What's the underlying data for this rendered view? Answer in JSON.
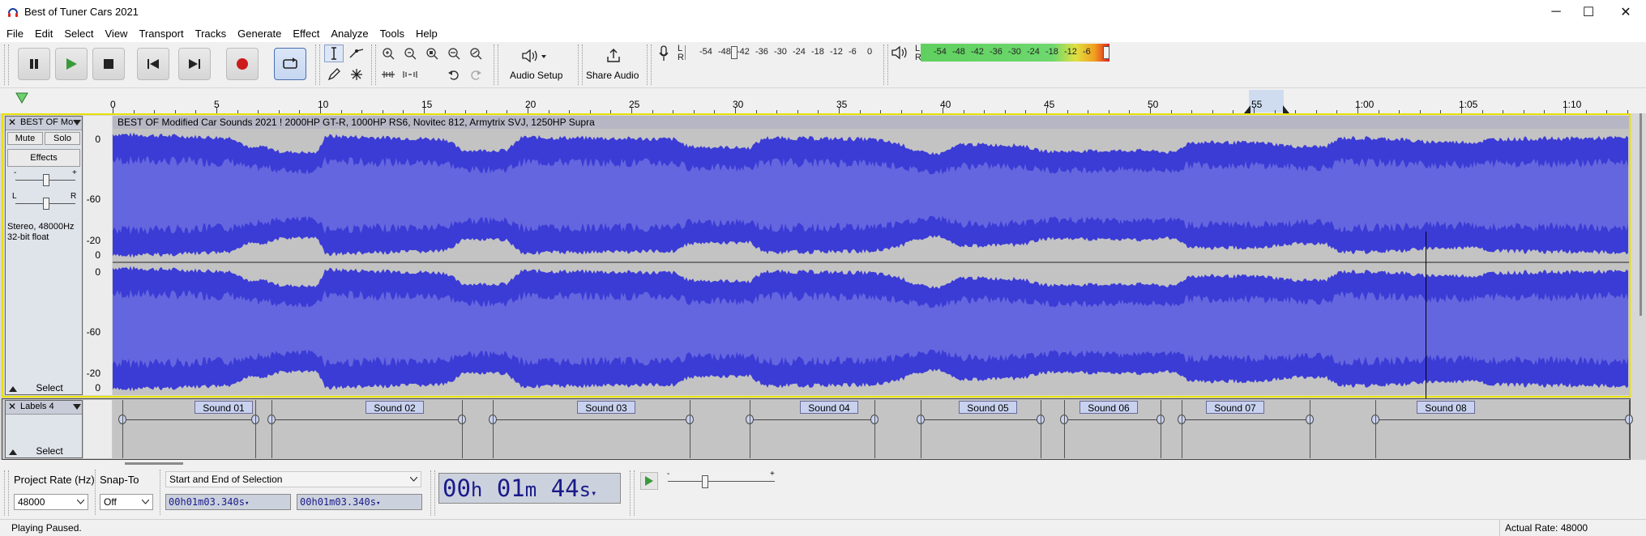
{
  "window": {
    "title": "Best of Tuner Cars 2021",
    "minimize": "─",
    "maximize": "☐",
    "close": "✕"
  },
  "menu": [
    "File",
    "Edit",
    "Select",
    "View",
    "Transport",
    "Tracks",
    "Generate",
    "Effect",
    "Analyze",
    "Tools",
    "Help"
  ],
  "toolbar": {
    "audio_setup_label": "Audio Setup",
    "share_audio_label": "Share Audio",
    "record_meter_ticks": [
      "-54",
      "-48",
      "-42",
      "-36",
      "-30",
      "-24",
      "-18",
      "-12",
      "-6",
      "0"
    ],
    "play_meter_ticks": [
      "-54",
      "-48",
      "-42",
      "-36",
      "-30",
      "-24",
      "-18",
      "-12",
      "-6"
    ],
    "record_meter_lr": [
      "L",
      "R"
    ],
    "play_meter_lr": [
      "L",
      "R"
    ]
  },
  "ruler": {
    "ticks": [
      "0",
      "5",
      "10",
      "15",
      "20",
      "25",
      "30",
      "35",
      "40",
      "45",
      "50",
      "55",
      "1:00",
      "1:05",
      "1:10"
    ]
  },
  "audio_track": {
    "name": "BEST OF Mo",
    "mute_label": "Mute",
    "solo_label": "Solo",
    "effects_label": "Effects",
    "gain_minus": "-",
    "gain_plus": "+",
    "pan_left": "L",
    "pan_right": "R",
    "format_line1": "Stereo, 48000Hz",
    "format_line2": "32-bit float",
    "select_label": "Select",
    "clip_title": "BEST OF Modified Car Sounds 2021 ! 2000HP GT-R, 1000HP RS6, Novitec 812, Armytrix SVJ, 1250HP Supra",
    "vruler_top": [
      "0",
      "-60",
      "-20",
      "0"
    ],
    "vruler_bottom": [
      "0",
      "-60",
      "-20",
      "0"
    ]
  },
  "label_track": {
    "name": "Labels 4",
    "select_label": "Select",
    "labels": [
      "Sound 01",
      "Sound 02",
      "Sound 03",
      "Sound 04",
      "Sound 05",
      "Sound 06",
      "Sound 07",
      "Sound 08"
    ]
  },
  "selection_toolbar": {
    "project_rate_label": "Project Rate (Hz)",
    "project_rate_value": "48000",
    "snap_to_label": "Snap-To",
    "snap_to_value": "Off",
    "selection_mode": "Start and End of Selection",
    "sel_start": {
      "h": "00",
      "m": "01",
      "s": "03.340"
    },
    "sel_end": {
      "h": "00",
      "m": "01",
      "s": "03.340"
    }
  },
  "time_display": {
    "h": "00",
    "m": "01",
    "s": "44"
  },
  "play_speed": {
    "minus": "-",
    "plus": "+"
  },
  "status": {
    "left": "Playing Paused.",
    "right": "Actual Rate: 48000"
  }
}
